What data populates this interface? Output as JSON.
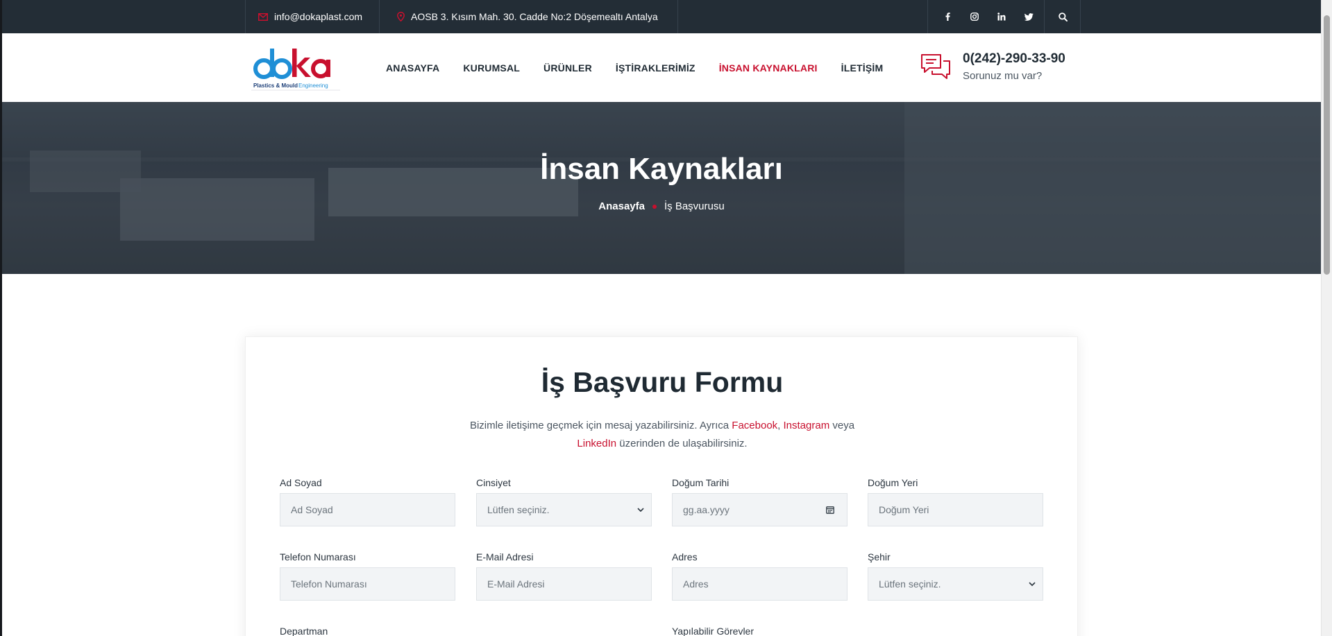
{
  "topbar": {
    "email": "info@dokaplast.com",
    "address": "AOSB 3. Kısım Mah. 30. Cadde No:2 Döşemealtı Antalya",
    "social": [
      "facebook-icon",
      "instagram-icon",
      "linkedin-icon",
      "twitter-icon"
    ]
  },
  "header": {
    "logo_text": "doka",
    "logo_tagline": "Plastics & Mould Engineering",
    "nav": [
      "ANASAYFA",
      "KURUMSAL",
      "ÜRÜNLER",
      "İŞTİRAKLERİMİZ",
      "İNSAN KAYNAKLARI",
      "İLETİŞİM"
    ],
    "active_nav": "İNSAN KAYNAKLARI",
    "phone": "0(242)-290-33-90",
    "phone_sub": "Sorunuz mu var?"
  },
  "hero": {
    "title": "İnsan Kaynakları",
    "breadcrumb_home": "Anasayfa",
    "breadcrumb_current": "İş Başvurusu"
  },
  "form": {
    "title_light": "İş Başvuru",
    "title_bold": "Formu",
    "intro_part1": "Bizimle iletişime geçmek için mesaj yazabilirsiniz. Ayrıca",
    "link_facebook": "Facebook",
    "comma": ",",
    "link_instagram": "Instagram",
    "intro_part2": "veya",
    "link_linkedin": "LinkedIn",
    "intro_part3": "üzerinden de ulaşabilirsiniz.",
    "fields": {
      "ad_soyad": {
        "label": "Ad Soyad",
        "placeholder": "Ad Soyad"
      },
      "cinsiyet": {
        "label": "Cinsiyet",
        "value": "Lütfen seçiniz."
      },
      "dogum_tarihi": {
        "label": "Doğum Tarihi",
        "placeholder": "gg.aa.yyyy"
      },
      "dogum_yeri": {
        "label": "Doğum Yeri",
        "placeholder": "Doğum Yeri"
      },
      "telefon": {
        "label": "Telefon Numarası",
        "placeholder": "Telefon Numarası"
      },
      "email": {
        "label": "E-Mail Adresi",
        "placeholder": "E-Mail Adresi"
      },
      "adres": {
        "label": "Adres",
        "placeholder": "Adres"
      },
      "sehir": {
        "label": "Şehir",
        "value": "Lütfen seçiniz."
      },
      "departman": {
        "label": "Departman"
      },
      "gorevler": {
        "label": "Yapılabilir Görevler"
      }
    }
  },
  "colors": {
    "accent": "#c8102e",
    "topbar": "#232d36",
    "text": "#1f2a33"
  }
}
